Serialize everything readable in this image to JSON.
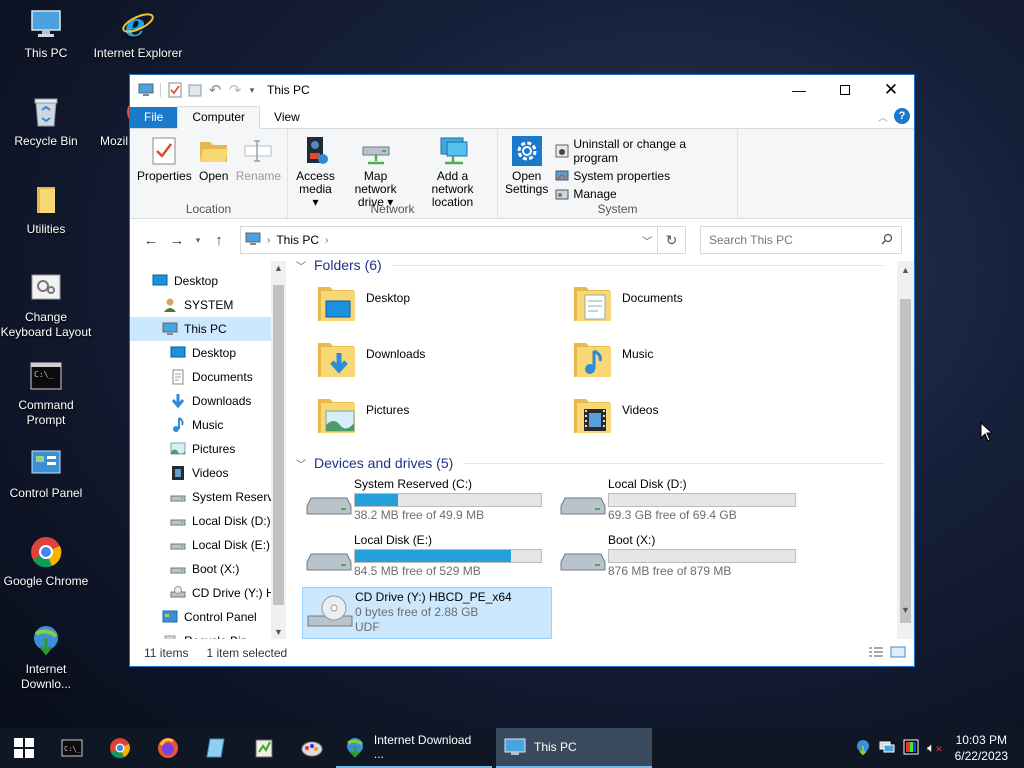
{
  "desktop": {
    "icons": [
      {
        "label": "This PC",
        "icon": "this-pc-icon"
      },
      {
        "label": "Internet Explorer",
        "icon": "internet-explorer-icon"
      },
      {
        "label": "Recycle Bin",
        "icon": "recycle-bin-icon"
      },
      {
        "label": "Mozil",
        "icon": "firefox-icon"
      },
      {
        "label": "Utilities",
        "icon": "folder-icon"
      },
      {
        "label": "Change Keyboard Layout",
        "icon": "keyboard-settings-icon"
      },
      {
        "label": "Command Prompt",
        "icon": "command-prompt-icon"
      },
      {
        "label": "Control Panel",
        "icon": "control-panel-icon"
      },
      {
        "label": "Google Chrome",
        "icon": "chrome-icon"
      },
      {
        "label": "Internet Downlo...",
        "icon": "internet-download-manager-icon"
      }
    ]
  },
  "window": {
    "title": "This PC",
    "tabs": {
      "file": "File",
      "computer": "Computer",
      "view": "View"
    },
    "ribbon": {
      "location": {
        "label": "Location",
        "properties": "Properties",
        "open": "Open",
        "rename": "Rename"
      },
      "network": {
        "label": "Network",
        "access_media_1": "Access",
        "access_media_2": "media",
        "map_drive_1": "Map network",
        "map_drive_2": "drive",
        "add_location_1": "Add a network",
        "add_location_2": "location"
      },
      "system": {
        "label": "System",
        "open_settings_1": "Open",
        "open_settings_2": "Settings",
        "uninstall": "Uninstall or change a program",
        "system_properties": "System properties",
        "manage": "Manage"
      }
    },
    "address": {
      "path": "This PC",
      "search_placeholder": "Search This PC"
    },
    "nav": [
      {
        "label": "Desktop",
        "icon": "desktop-blue-icon",
        "level": 0
      },
      {
        "label": "SYSTEM",
        "icon": "user-icon",
        "level": 1
      },
      {
        "label": "This PC",
        "icon": "this-pc-icon",
        "level": 1,
        "selected": true
      },
      {
        "label": "Desktop",
        "icon": "desktop-icon",
        "level": 2
      },
      {
        "label": "Documents",
        "icon": "documents-icon",
        "level": 2
      },
      {
        "label": "Downloads",
        "icon": "downloads-icon",
        "level": 2
      },
      {
        "label": "Music",
        "icon": "music-icon",
        "level": 2
      },
      {
        "label": "Pictures",
        "icon": "pictures-icon",
        "level": 2
      },
      {
        "label": "Videos",
        "icon": "videos-icon",
        "level": 2
      },
      {
        "label": "System Reserve",
        "icon": "drive-icon",
        "level": 2
      },
      {
        "label": "Local Disk (D:)",
        "icon": "drive-icon",
        "level": 2
      },
      {
        "label": "Local Disk (E:)",
        "icon": "drive-icon",
        "level": 2
      },
      {
        "label": "Boot (X:)",
        "icon": "drive-icon",
        "level": 2
      },
      {
        "label": "CD Drive (Y:) H",
        "icon": "cd-drive-icon",
        "level": 2
      },
      {
        "label": "Control Panel",
        "icon": "control-panel-icon",
        "level": 1
      },
      {
        "label": "Recycle Bin",
        "icon": "recycle-bin-icon",
        "level": 1
      }
    ],
    "folders_header": "Folders (6)",
    "folders": [
      {
        "label": "Desktop",
        "icon": "desktop-folder-icon"
      },
      {
        "label": "Documents",
        "icon": "documents-folder-icon"
      },
      {
        "label": "Downloads",
        "icon": "downloads-folder-icon"
      },
      {
        "label": "Music",
        "icon": "music-folder-icon"
      },
      {
        "label": "Pictures",
        "icon": "pictures-folder-icon"
      },
      {
        "label": "Videos",
        "icon": "videos-folder-icon"
      }
    ],
    "drives_header": "Devices and drives (5)",
    "drives": [
      {
        "label": "System Reserved (C:)",
        "free": "38.2 MB free of 49.9 MB",
        "used_fraction": 0.23
      },
      {
        "label": "Local Disk (D:)",
        "free": "69.3 GB free of 69.4 GB",
        "used_fraction": 0.0
      },
      {
        "label": "Local Disk (E:)",
        "free": "84.5 MB free of 529 MB",
        "used_fraction": 0.84
      },
      {
        "label": "Boot (X:)",
        "free": "876 MB free of 879 MB",
        "used_fraction": 0.0
      },
      {
        "label": "CD Drive (Y:) HBCD_PE_x64",
        "free": "0 bytes free of 2.88 GB",
        "fs": "UDF",
        "selected": true
      }
    ],
    "status": {
      "items": "11 items",
      "selected": "1 item selected"
    }
  },
  "taskbar": {
    "apps": [
      {
        "label": "Internet Download ...",
        "icon": "internet-download-manager-icon"
      },
      {
        "label": "This PC",
        "icon": "this-pc-icon"
      }
    ],
    "time": "10:03 PM",
    "date": "6/22/2023"
  },
  "colors": {
    "accent": "#1979ca",
    "bar_fill": "#26a0da",
    "selection": "#cce8ff"
  }
}
